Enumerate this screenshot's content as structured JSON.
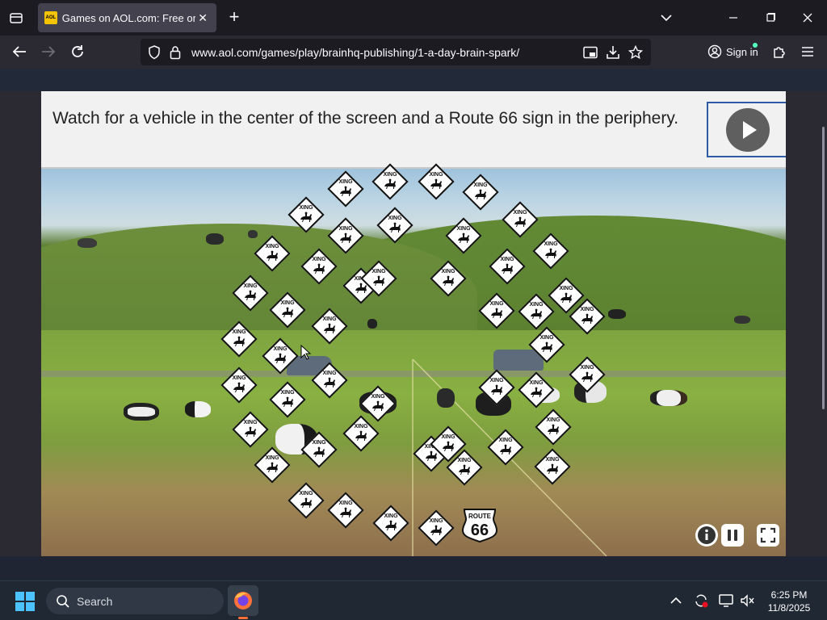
{
  "browser": {
    "tab": {
      "favicon_text": "AOL",
      "title": "Games on AOL.com: Free online games"
    },
    "url": "www.aol.com/games/play/brainhq-publishing/1-a-day-brain-spark/",
    "sign_in_label": "Sign in"
  },
  "game": {
    "instruction": "Watch for a vehicle in the center of the screen and a Route 66 sign in the periphery.",
    "sign_label": "XING",
    "route66_top": "ROUTE",
    "route66_number": "66"
  },
  "taskbar": {
    "search_placeholder": "Search",
    "time": "6:25 PM",
    "date": "11/8/2025"
  },
  "colors": {
    "accent_firefox": "#ff7139",
    "play_border": "#2f5aa8"
  }
}
